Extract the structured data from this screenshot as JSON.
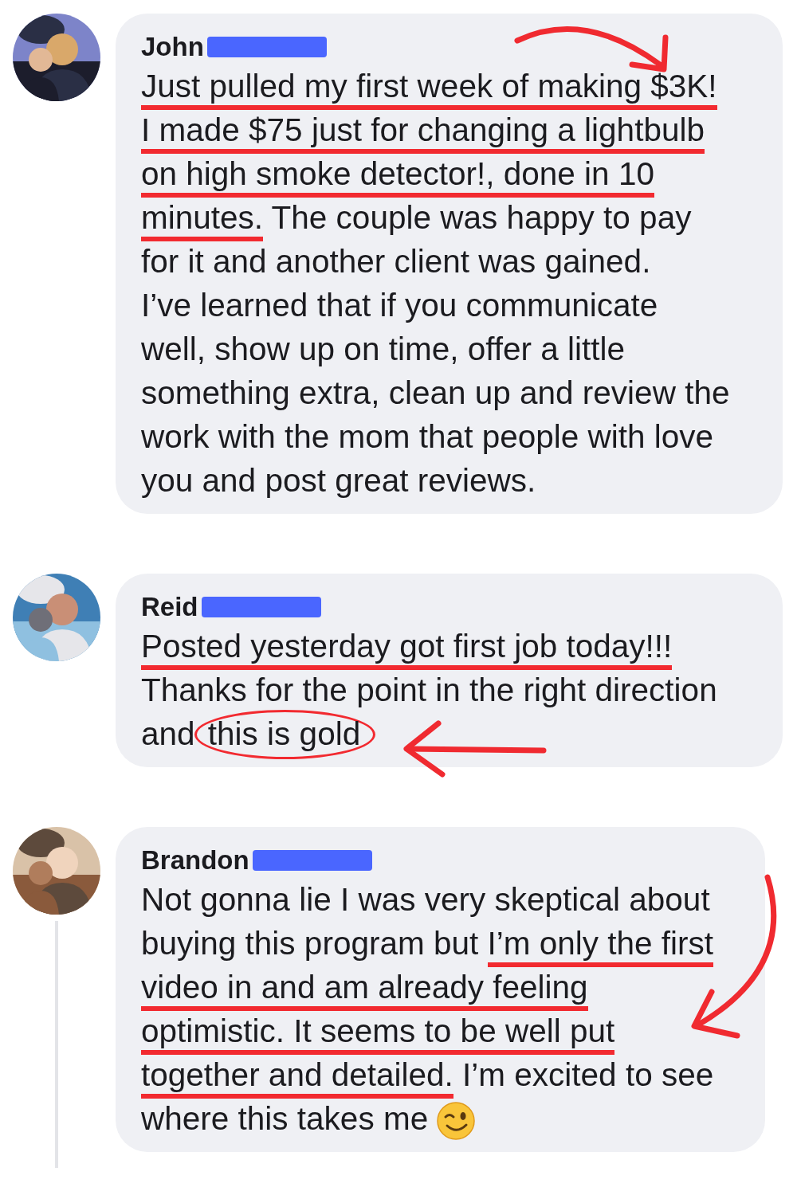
{
  "comments": [
    {
      "author": "John",
      "redacted": true,
      "arrow": {
        "kind": "curve-right"
      },
      "thread_line": false,
      "has_emoji": false,
      "lines": [
        [
          {
            "text": "Just pulled my first week of making $3K!",
            "underlined": true,
            "circled": false
          }
        ],
        [
          {
            "text": "I made $75 just for changing a lightbulb",
            "underlined": true,
            "circled": false
          }
        ],
        [
          {
            "text": "on high smoke detector!, done in 10",
            "underlined": true,
            "circled": false
          }
        ],
        [
          {
            "text": "minutes.",
            "underlined": true,
            "circled": false
          },
          {
            "text": " The couple was happy to pay",
            "underlined": false,
            "circled": false
          }
        ],
        [
          {
            "text": "for it and another client was gained.",
            "underlined": false,
            "circled": false
          }
        ],
        [
          {
            "text": "I’ve learned that if you communicate",
            "underlined": false,
            "circled": false
          }
        ],
        [
          {
            "text": "well, show up on time, offer a little",
            "underlined": false,
            "circled": false
          }
        ],
        [
          {
            "text": "something extra, clean up and review the",
            "underlined": false,
            "circled": false
          }
        ],
        [
          {
            "text": "work with the mom that people with love",
            "underlined": false,
            "circled": false
          }
        ],
        [
          {
            "text": "you and post great reviews.",
            "underlined": false,
            "circled": false
          }
        ]
      ]
    },
    {
      "author": "Reid",
      "redacted": true,
      "arrow": {
        "kind": "left"
      },
      "thread_line": false,
      "has_emoji": false,
      "lines": [
        [
          {
            "text": "Posted yesterday got first job today!!!",
            "underlined": true,
            "circled": false
          }
        ],
        [
          {
            "text": "Thanks for the point in the right direction",
            "underlined": false,
            "circled": false
          }
        ],
        [
          {
            "text": "and ",
            "underlined": false,
            "circled": false
          },
          {
            "text": "this is gold",
            "underlined": false,
            "circled": true
          }
        ]
      ]
    },
    {
      "author": "Brandon",
      "redacted": true,
      "arrow": {
        "kind": "curve-down"
      },
      "thread_line": true,
      "has_emoji": true,
      "lines": [
        [
          {
            "text": "Not gonna lie I was very skeptical about",
            "underlined": false,
            "circled": false
          }
        ],
        [
          {
            "text": "buying this program but ",
            "underlined": false,
            "circled": false
          },
          {
            "text": "I’m only the first",
            "underlined": true,
            "circled": false
          }
        ],
        [
          {
            "text": "video in and am already feeling",
            "underlined": true,
            "circled": false
          }
        ],
        [
          {
            "text": "optimistic. It seems to be well put",
            "underlined": true,
            "circled": false
          }
        ],
        [
          {
            "text": "together and detailed.",
            "underlined": true,
            "circled": false
          },
          {
            "text": " I’m excited to see",
            "underlined": false,
            "circled": false
          }
        ],
        [
          {
            "text": "where this takes me",
            "underlined": false,
            "circled": false
          }
        ]
      ]
    }
  ]
}
